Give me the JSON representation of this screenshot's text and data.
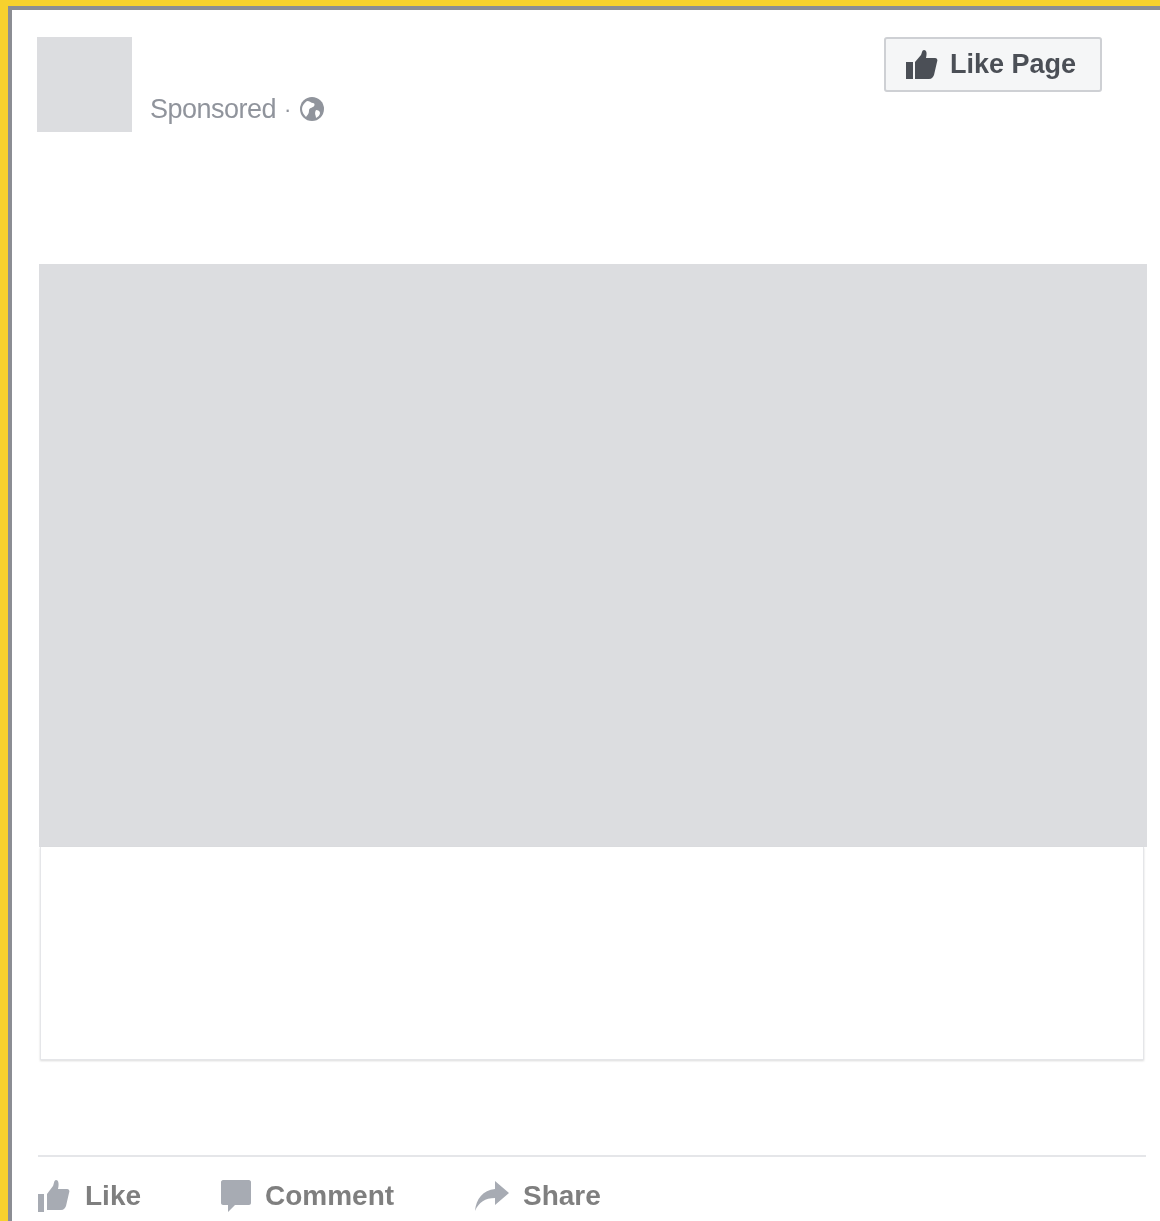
{
  "post": {
    "sponsored_label": "Sponsored",
    "separator": "·",
    "like_page_button": "Like Page"
  },
  "actions": [
    {
      "kind": "like",
      "label": "Like"
    },
    {
      "kind": "comment",
      "label": "Comment"
    },
    {
      "kind": "share",
      "label": "Share"
    }
  ]
}
